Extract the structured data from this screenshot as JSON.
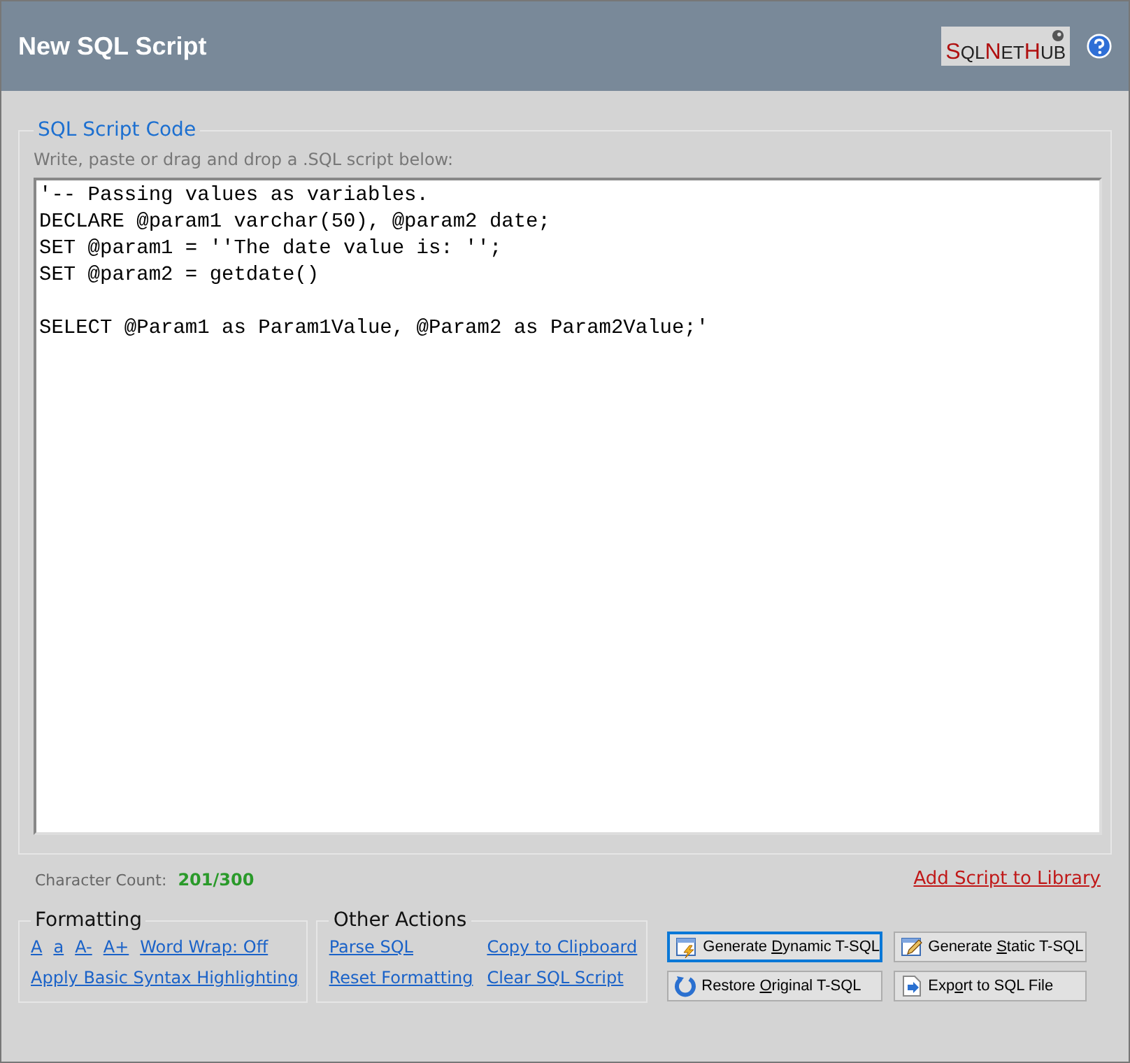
{
  "window": {
    "title": "New SQL Script",
    "logo": [
      {
        "text": "S",
        "accent": true
      },
      {
        "text": "QL",
        "accent": false
      },
      {
        "text": "N",
        "accent": true
      },
      {
        "text": "ET",
        "accent": false
      },
      {
        "text": "H",
        "accent": true
      },
      {
        "text": "UB",
        "accent": false
      }
    ]
  },
  "script_group": {
    "title": "SQL Script Code",
    "hint": "Write, paste or drag and drop a .SQL script below:",
    "code": "'-- Passing values as variables.\nDECLARE @param1 varchar(50), @param2 date;\nSET @param1 = ''The date value is: '';\nSET @param2 = getdate()\n\nSELECT @Param1 as Param1Value, @Param2 as Param2Value;'"
  },
  "character_count": {
    "label": "Character Count:",
    "value": "201/300"
  },
  "add_link": "Add Script to Library",
  "formatting": {
    "title": "Formatting",
    "links": [
      "A",
      "a",
      "A-",
      "A+",
      "Word Wrap: Off"
    ],
    "syntax_link": "Apply Basic Syntax Highlighting"
  },
  "other_actions": {
    "title": "Other Actions",
    "links": [
      "Parse SQL",
      "Copy to Clipboard",
      "Reset Formatting",
      "Clear SQL Script"
    ]
  },
  "buttons": [
    {
      "kind": "dynamic",
      "parts": [
        "Generate ",
        "D",
        "ynamic T-SQL"
      ],
      "focused": true
    },
    {
      "kind": "static",
      "parts": [
        "Generate ",
        "S",
        "tatic T-SQL"
      ],
      "focused": false
    },
    {
      "kind": "restore",
      "parts": [
        "Restore ",
        "O",
        "riginal T-SQL"
      ],
      "focused": false
    },
    {
      "kind": "export",
      "parts": [
        "Exp",
        "o",
        "rt to SQL File"
      ],
      "focused": false
    }
  ]
}
